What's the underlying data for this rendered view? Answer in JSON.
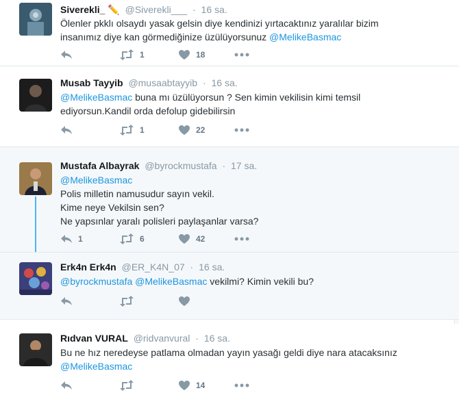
{
  "tweets": [
    {
      "name": "Siverekli_",
      "handle": "@Siverekli___",
      "time": "16 sa.",
      "text_lines": [
        [
          "Ölenler pkklı olsaydı yasak gelsin diye kendinizi yırtacaktınız yaralılar bizim"
        ],
        [
          "insanımız diye kan görmediğinize üzülüyorsunuz ",
          "@MelikeBasmac"
        ]
      ],
      "replies": "",
      "retweets": "1",
      "likes": "18"
    },
    {
      "name": "Musab Tayyib",
      "handle": "@musaabtayyib",
      "time": "16 sa.",
      "text_lines": [
        [
          "@MelikeBasmac",
          " buna mı üzülüyorsun ? Sen kimin vekilisin kimi temsil"
        ],
        [
          "ediyorsun.Kandil orda defolup gidebilirsin"
        ]
      ],
      "replies": "",
      "retweets": "1",
      "likes": "22"
    },
    {
      "name": "Mustafa Albayrak",
      "handle": "@byrockmustafa",
      "time": "17 sa.",
      "text_lines": [
        [
          "@MelikeBasmac"
        ],
        [
          "Polis milletin namusudur sayın vekil."
        ],
        [
          "Kime neye Vekilsin sen?"
        ],
        [
          "Ne yapsınlar yaralı polisleri paylaşanlar varsa?"
        ]
      ],
      "replies": "1",
      "retweets": "6",
      "likes": "42"
    },
    {
      "name": "Erk4n Erk4n",
      "handle": "@ER_K4N_07",
      "time": "16 sa.",
      "text_lines": [
        [
          "@byrockmustafa",
          " ",
          "@MelikeBasmac",
          " vekilmi?  Kimin vekili bu?"
        ]
      ],
      "replies": "",
      "retweets": "",
      "likes": ""
    },
    {
      "name": "Rıdvan VURAL",
      "handle": "@ridvanvural",
      "time": "16 sa.",
      "text_lines": [
        [
          "Bu ne hız neredeyse patlama olmadan yayın yasağı geldi diye nara atacaksınız"
        ],
        [
          "@MelikeBasmac"
        ]
      ],
      "replies": "",
      "retweets": "",
      "likes": "14"
    }
  ],
  "icons": {
    "reply": "reply-icon",
    "retweet": "retweet-icon",
    "like": "heart-icon",
    "more": "more-icon",
    "edit_emoji": "pencil-icon"
  },
  "colors": {
    "link": "#1b95e0",
    "meta": "#8899a6",
    "thread": "#4ab3f4",
    "conversation_bg": "#f5f8fa"
  }
}
